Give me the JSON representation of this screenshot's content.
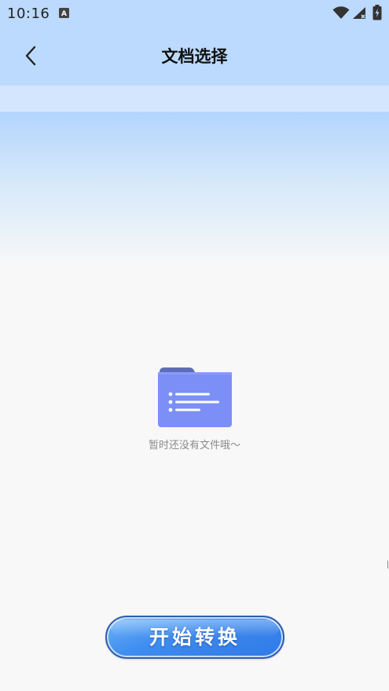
{
  "status_bar": {
    "time": "10:16",
    "icons": [
      "a-notification-icon",
      "wifi-icon",
      "signal-icon",
      "battery-icon"
    ]
  },
  "nav": {
    "title": "文档选择",
    "back_icon": "chevron-left-icon"
  },
  "empty_state": {
    "icon": "folder-list-icon",
    "message": "暂时还没有文件哦～"
  },
  "actions": {
    "start_label": "开始转换"
  },
  "colors": {
    "header_bg": "#bcdafd",
    "page_bg": "#f8f8f8",
    "folder": "#7b8ff7",
    "button": "#3f8ef0"
  }
}
